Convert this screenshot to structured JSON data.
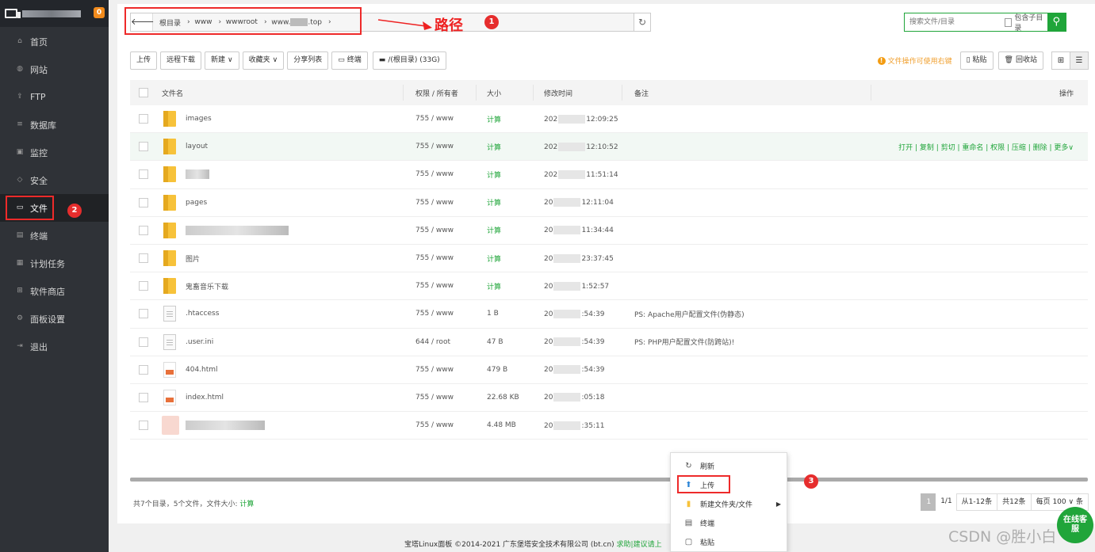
{
  "sidebar": {
    "badge": "0",
    "items": [
      {
        "label": "首页",
        "icon": "home-icon",
        "glyph": "⌂"
      },
      {
        "label": "网站",
        "icon": "globe-icon",
        "glyph": "◍"
      },
      {
        "label": "FTP",
        "icon": "ftp-icon",
        "glyph": "⇪"
      },
      {
        "label": "数据库",
        "icon": "database-icon",
        "glyph": "≡"
      },
      {
        "label": "监控",
        "icon": "monitor-icon",
        "glyph": "▣"
      },
      {
        "label": "安全",
        "icon": "shield-icon",
        "glyph": "◇"
      },
      {
        "label": "文件",
        "icon": "folder-icon",
        "glyph": "▭"
      },
      {
        "label": "终端",
        "icon": "terminal-icon",
        "glyph": "▤"
      },
      {
        "label": "计划任务",
        "icon": "calendar-icon",
        "glyph": "▦"
      },
      {
        "label": "软件商店",
        "icon": "apps-icon",
        "glyph": "⊞"
      },
      {
        "label": "面板设置",
        "icon": "gear-icon",
        "glyph": "⚙"
      },
      {
        "label": "退出",
        "icon": "logout-icon",
        "glyph": "⇥"
      }
    ]
  },
  "annotations": {
    "n1": "1",
    "n2": "2",
    "n3": "3",
    "path_label": "路径"
  },
  "path": {
    "back_glyph": "🡐",
    "crumbs": [
      "根目录",
      "www",
      "wwwroot",
      "www.",
      ".top"
    ],
    "sep": "›",
    "refresh_glyph": "↻"
  },
  "search": {
    "placeholder": "搜索文件/目录",
    "include_sub": "包含子目录",
    "btn_glyph": "⚲"
  },
  "toolbar": {
    "upload": "上传",
    "remote_download": "远程下载",
    "new": "新建",
    "favorites": "收藏夹",
    "share_list": "分享列表",
    "terminal": "终端",
    "disk": "/(根目录) (33G)",
    "tip": "文件操作可使用右键",
    "paste": "粘贴",
    "recycle": "回收站"
  },
  "table": {
    "headers": {
      "name": "文件名",
      "perm": "权限 / 所有者",
      "size": "大小",
      "mtime": "修改时间",
      "note": "备注",
      "ops": "操作"
    },
    "rows": [
      {
        "name": "images",
        "type": "folder",
        "perm": "755 / www",
        "size": "计算",
        "time_a": "202",
        "time_b": "12:09:25",
        "note": ""
      },
      {
        "name": "layout",
        "type": "folder",
        "perm": "755 / www",
        "size": "计算",
        "time_a": "202",
        "time_b": "12:10:52",
        "note": ""
      },
      {
        "name": "",
        "type": "folder",
        "perm": "755 / www",
        "size": "计算",
        "time_a": "202",
        "time_b": "11:51:14",
        "note": ""
      },
      {
        "name": "pages",
        "type": "folder",
        "perm": "755 / www",
        "size": "计算",
        "time_a": "20",
        "time_b": "12:11:04",
        "note": ""
      },
      {
        "name": "",
        "type": "folder",
        "perm": "755 / www",
        "size": "计算",
        "time_a": "20",
        "time_b": "11:34:44",
        "note": ""
      },
      {
        "name": "图片",
        "type": "folder",
        "perm": "755 / www",
        "size": "计算",
        "time_a": "20",
        "time_b": "23:37:45",
        "note": ""
      },
      {
        "name": "鬼畜音乐下载",
        "type": "folder",
        "perm": "755 / www",
        "size": "计算",
        "time_a": "20",
        "time_b": "1:52:57",
        "note": ""
      },
      {
        "name": ".htaccess",
        "type": "file",
        "perm": "755 / www",
        "size": "1 B",
        "time_a": "20",
        "time_b": ":54:39",
        "note": "PS: Apache用户配置文件(伪静态)"
      },
      {
        "name": ".user.ini",
        "type": "file",
        "perm": "644 / root",
        "size": "47 B",
        "time_a": "20",
        "time_b": ":54:39",
        "note": "PS: PHP用户配置文件(防跨站)!"
      },
      {
        "name": "404.html",
        "type": "html",
        "perm": "755 / www",
        "size": "479 B",
        "time_a": "20",
        "time_b": ":54:39",
        "note": ""
      },
      {
        "name": "index.html",
        "type": "html",
        "perm": "755 / www",
        "size": "22.68 KB",
        "time_a": "20",
        "time_b": ":05:18",
        "note": ""
      },
      {
        "name": "",
        "type": "blur",
        "perm": "755 / www",
        "size": "4.48 MB",
        "time_a": "20",
        "time_b": ":35:11",
        "note": ""
      }
    ],
    "row_ops": "打开 | 复制 | 剪切 | 重命名 | 权限 | 压缩 | 删除 | 更多∨"
  },
  "footer": {
    "summary": "共7个目录，5个文件，文件大小: ",
    "summary_link": "计算",
    "pager": {
      "current": "1",
      "pages": "1/1",
      "range": "从1-12条",
      "total": "共12条",
      "per_page_label": "每页",
      "per_page": "100",
      "unit": "条"
    }
  },
  "copyright": {
    "text": "宝塔Linux面板 ©2014-2021 广东堡塔安全技术有限公司 (bt.cn)  ",
    "links": "求助|建议请上"
  },
  "context_menu": {
    "items": [
      {
        "label": "刷新",
        "glyph": "↻"
      },
      {
        "label": "上传",
        "glyph": "⬆"
      },
      {
        "label": "新建文件夹/文件",
        "glyph": "▮"
      },
      {
        "label": "终端",
        "glyph": "▤"
      },
      {
        "label": "粘贴",
        "glyph": "▢"
      }
    ]
  },
  "chat": {
    "label": "在线客服"
  },
  "watermark": "CSDN @胜小白",
  "colors": {
    "accent": "#20a53a",
    "annotation": "#e62d2d",
    "sidebar": "#2f3237"
  }
}
